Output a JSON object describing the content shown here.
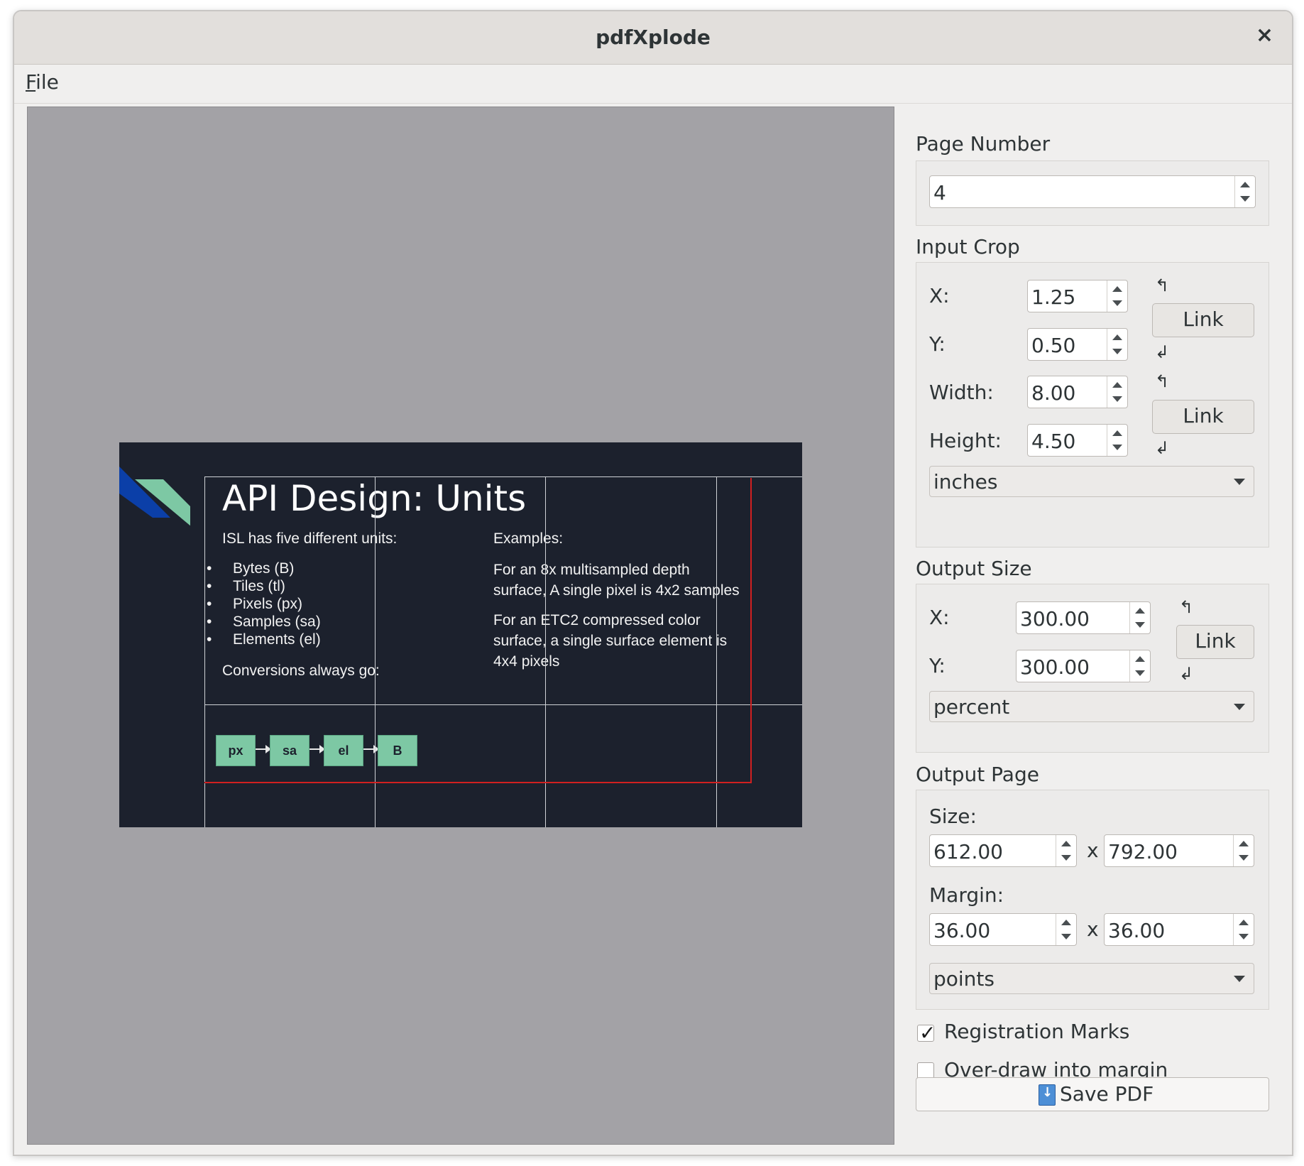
{
  "window": {
    "title": "pdfXplode",
    "close_label": "×"
  },
  "menu": {
    "file_underlined": "F",
    "file_rest": "ile"
  },
  "slide": {
    "title": "API Design: Units",
    "intro": "ISL has five different units:",
    "bullets": [
      "Bytes (B)",
      "Tiles (tl)",
      "Pixels (px)",
      "Samples (sa)",
      "Elements (el)"
    ],
    "conversions": "Conversions always go:",
    "chips": [
      "px",
      "sa",
      "el",
      "B"
    ],
    "examples_label": "Examples:",
    "example1_line1": "For an 8x multisampled depth",
    "example1_line2": "surface, A single pixel is 4x2 samples",
    "example2_line1": "For an ETC2 compressed color",
    "example2_line2": "surface, a single surface element is",
    "example2_line3": "4x4 pixels",
    "colors": {
      "background": "#1c212d",
      "accent_green": "#7dc8a4",
      "accent_blue": "#0b3fa8",
      "crop_red": "#d12020"
    }
  },
  "panel": {
    "page_number": {
      "label": "Page Number",
      "value": "4"
    },
    "input_crop": {
      "label": "Input Crop",
      "x_label": "X:",
      "x_value": "1.25",
      "y_label": "Y:",
      "y_value": "0.50",
      "width_label": "Width:",
      "width_value": "8.00",
      "height_label": "Height:",
      "height_value": "4.50",
      "link_label": "Link",
      "units": "inches"
    },
    "output_size": {
      "label": "Output Size",
      "x_label": "X:",
      "x_value": "300.00",
      "y_label": "Y:",
      "y_value": "300.00",
      "link_label": "Link",
      "units": "percent"
    },
    "output_page": {
      "label": "Output Page",
      "size_label": "Size:",
      "size_w": "612.00",
      "size_h": "792.00",
      "margin_label": "Margin:",
      "margin_w": "36.00",
      "margin_h": "36.00",
      "separator": "x",
      "units": "points"
    },
    "registration_marks": {
      "label": "Registration Marks",
      "checked": true
    },
    "overdraw": {
      "label": "Over-draw into margin",
      "checked": false
    },
    "save_label": "Save PDF"
  },
  "link_arrows": {
    "top": "↰",
    "bottom": "↲"
  }
}
